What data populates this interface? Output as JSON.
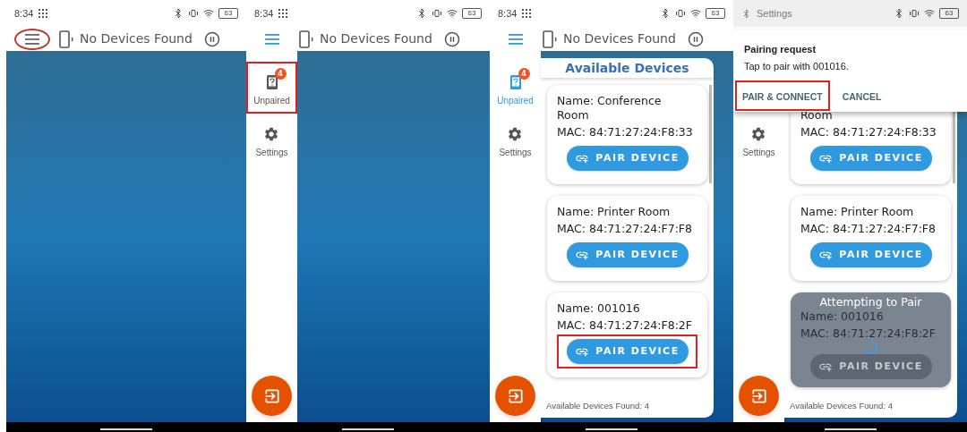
{
  "screens": [
    {
      "status_bar": {
        "kind": "clock",
        "time": "8:34",
        "battery": "63"
      },
      "app_bar": {
        "menu_open": false,
        "menu_highlighted": true,
        "title": "No Devices Found"
      },
      "content": {
        "kind": "empty"
      }
    },
    {
      "status_bar": {
        "kind": "clock",
        "time": "8:34",
        "battery": "63"
      },
      "app_bar": {
        "menu_open": true,
        "menu_highlighted": false,
        "title": "No Devices Found"
      },
      "drawer": {
        "top_covered": false,
        "items": [
          {
            "kind": "unpaired",
            "label": "Unpaired",
            "badge": "4",
            "selected": false,
            "highlighted": true
          },
          {
            "kind": "settings",
            "label": "Settings",
            "selected": false,
            "highlighted": false
          }
        ]
      },
      "content": {
        "kind": "empty"
      }
    },
    {
      "status_bar": {
        "kind": "clock",
        "time": "8:34",
        "battery": "63"
      },
      "app_bar": {
        "menu_open": true,
        "menu_highlighted": false,
        "title": "No Devices Found"
      },
      "drawer": {
        "top_covered": false,
        "items": [
          {
            "kind": "unpaired",
            "label": "Unpaired",
            "badge": "4",
            "selected": true,
            "highlighted": false
          },
          {
            "kind": "settings",
            "label": "Settings",
            "selected": false,
            "highlighted": false
          }
        ]
      },
      "content": {
        "kind": "devices",
        "header": "Available Devices",
        "footer": "Available Devices Found: 4",
        "devices": [
          {
            "clipped_top": false,
            "name": "Name:  Conference Room",
            "mac": "MAC:  84:71:27:24:F8:33",
            "button": "PAIR DEVICE",
            "highlighted": false,
            "pairing": false
          },
          {
            "clipped_top": false,
            "name": "Name:  Printer Room",
            "mac": "MAC:  84:71:27:24:F7:F8",
            "button": "PAIR DEVICE",
            "highlighted": false,
            "pairing": false
          },
          {
            "clipped_top": false,
            "name": "Name:  001016",
            "mac": "MAC:  84:71:27:24:F8:2F",
            "button": "PAIR DEVICE",
            "highlighted": true,
            "pairing": false
          }
        ]
      }
    },
    {
      "status_bar": {
        "kind": "notification",
        "title": "Settings",
        "battery": "63"
      },
      "dialog": {
        "title": "Pairing request",
        "message": "Tap to pair with 001016.",
        "actions": [
          {
            "label": "PAIR & CONNECT",
            "highlighted": true
          },
          {
            "label": "CANCEL",
            "highlighted": false
          }
        ]
      },
      "drawer": {
        "top_covered": true,
        "items": [
          {
            "kind": "settings",
            "label": "Settings",
            "selected": false,
            "highlighted": false
          }
        ]
      },
      "content": {
        "kind": "devices",
        "footer": "Available Devices Found: 4",
        "devices": [
          {
            "clipped_top": true,
            "name": "Room",
            "mac": "MAC:  84:71:27:24:F8:33",
            "button": "PAIR DEVICE",
            "highlighted": false,
            "pairing": false
          },
          {
            "clipped_top": false,
            "name": "Name:  Printer Room",
            "mac": "MAC:  84:71:27:24:F7:F8",
            "button": "PAIR DEVICE",
            "highlighted": false,
            "pairing": false
          },
          {
            "clipped_top": false,
            "name": "Name:  001016",
            "mac": "MAC:  84:71:27:24:F8:2F",
            "button": "PAIR DEVICE",
            "highlighted": false,
            "pairing": true,
            "overlay_text": "Attempting to Pair"
          }
        ]
      }
    }
  ]
}
